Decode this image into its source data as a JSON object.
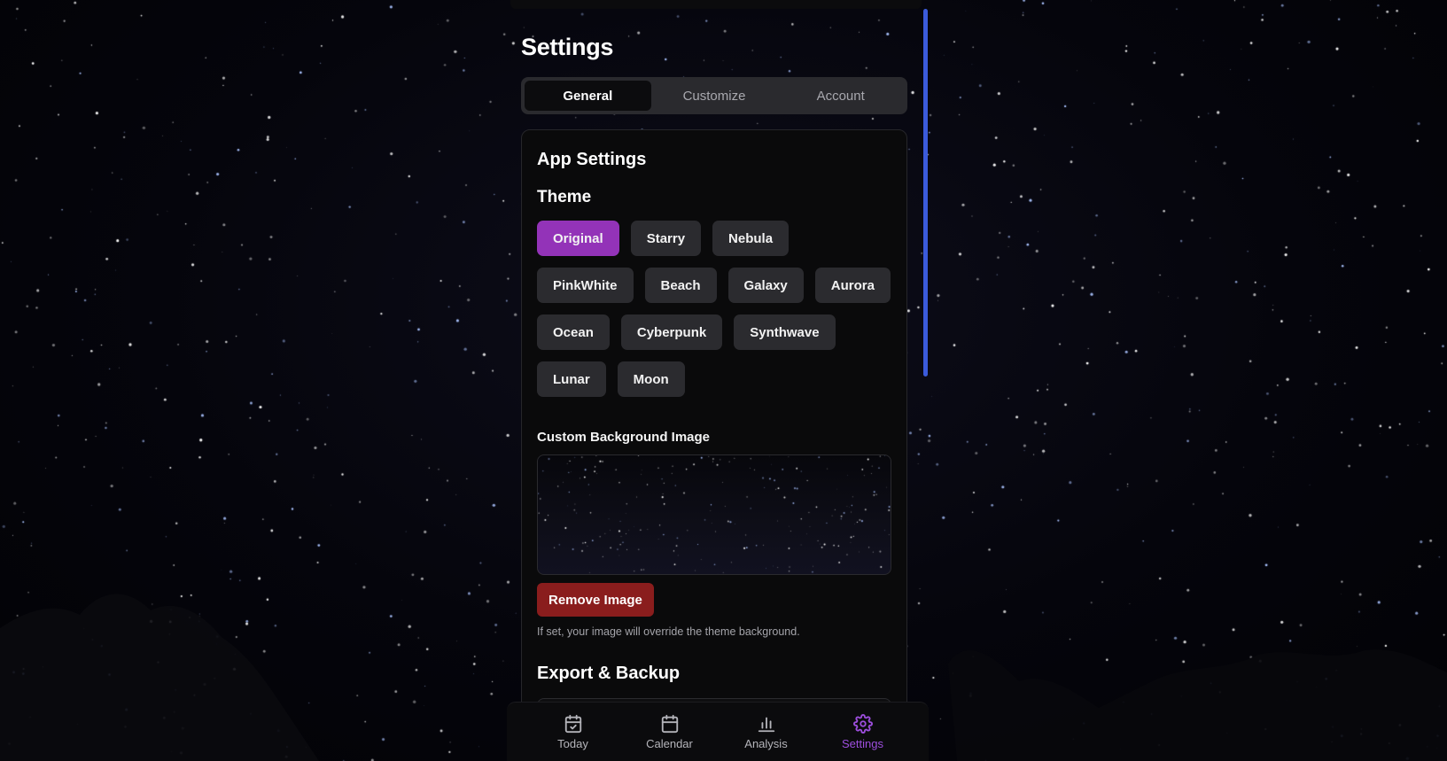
{
  "page": {
    "title": "Settings"
  },
  "tabs": [
    {
      "label": "General",
      "active": true
    },
    {
      "label": "Customize",
      "active": false
    },
    {
      "label": "Account",
      "active": false
    }
  ],
  "app_settings": {
    "title": "App Settings",
    "theme_heading": "Theme",
    "themes": [
      {
        "label": "Original",
        "active": true
      },
      {
        "label": "Starry",
        "active": false
      },
      {
        "label": "Nebula",
        "active": false
      },
      {
        "label": "PinkWhite",
        "active": false
      },
      {
        "label": "Beach",
        "active": false
      },
      {
        "label": "Galaxy",
        "active": false
      },
      {
        "label": "Aurora",
        "active": false
      },
      {
        "label": "Ocean",
        "active": false
      },
      {
        "label": "Cyberpunk",
        "active": false
      },
      {
        "label": "Synthwave",
        "active": false
      },
      {
        "label": "Lunar",
        "active": false
      },
      {
        "label": "Moon",
        "active": false
      }
    ],
    "custom_bg_label": "Custom Background Image",
    "remove_button": "Remove Image",
    "hint": "If set, your image will override the theme background.",
    "export_heading": "Export & Backup"
  },
  "nav": [
    {
      "label": "Today",
      "icon": "calendar-check-icon",
      "active": false
    },
    {
      "label": "Calendar",
      "icon": "calendar-icon",
      "active": false
    },
    {
      "label": "Analysis",
      "icon": "bar-chart-icon",
      "active": false
    },
    {
      "label": "Settings",
      "icon": "gear-icon",
      "active": true
    }
  ],
  "colors": {
    "accent": "#9d4edd",
    "active_theme": "#9333b8",
    "danger": "#8a1d1d",
    "scrollbar": "#3b5bdb"
  }
}
